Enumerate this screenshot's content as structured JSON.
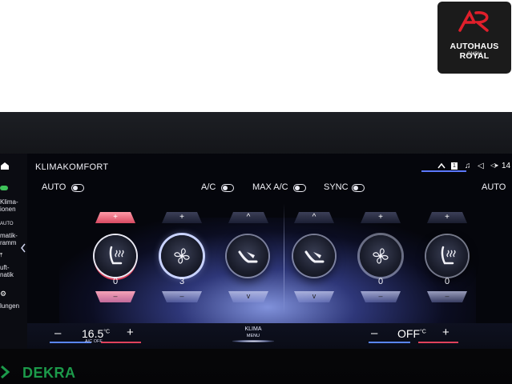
{
  "logo": {
    "brand": "AUTOHAUS ROYAL",
    "sub": "GMBH",
    "mark": "AR",
    "accent": "#e01f2b"
  },
  "screen": {
    "title": "KLIMAKOMFORT",
    "status": {
      "time": "14"
    }
  },
  "sidebar": {
    "items": [
      {
        "label": "Klima-",
        "label2": "ionen"
      },
      {
        "label": "AUTO",
        "label2": ""
      },
      {
        "label": "matik-",
        "label2": "ramm"
      },
      {
        "label": "uft-",
        "label2": "natik"
      },
      {
        "label": "lungen",
        "label2": ""
      }
    ]
  },
  "toggles": {
    "auto_left": "AUTO",
    "ac": "A/C",
    "max_ac": "MAX A/C",
    "sync": "SYNC",
    "auto_right": "AUTO"
  },
  "controls": {
    "left": [
      {
        "name": "seat-heating-left",
        "icon": "seat-heat-icon",
        "level": "0",
        "top": "+",
        "bottom": "–",
        "active": true
      },
      {
        "name": "fan-left",
        "icon": "fan-icon",
        "level": "3",
        "top": "+",
        "bottom": "–",
        "active": false
      },
      {
        "name": "seat-ventilation-left",
        "icon": "seat-recline-icon",
        "level": "",
        "top": "^",
        "bottom": "v",
        "active": false
      }
    ],
    "right": [
      {
        "name": "seat-ventilation-right",
        "icon": "seat-recline-icon",
        "level": "",
        "top": "^",
        "bottom": "v",
        "active": false
      },
      {
        "name": "fan-right",
        "icon": "fan-icon",
        "level": "0",
        "top": "+",
        "bottom": "–",
        "active": false
      },
      {
        "name": "seat-heating-right",
        "icon": "seat-heat-icon",
        "level": "0",
        "top": "+",
        "bottom": "–",
        "active": false
      }
    ]
  },
  "bottom": {
    "left_minus": "–",
    "left_temp": "16.5",
    "left_unit": "°C",
    "left_plus": "+",
    "left_sub": "A/C OFF",
    "klima_label": "KLIMA",
    "klima_sub": "MENU",
    "right_minus": "–",
    "right_temp": "OFF",
    "right_unit": "°C",
    "right_plus": "+"
  },
  "footer": {
    "dekra": "DEKRA",
    "dekra_color": "#1c9a4a"
  }
}
